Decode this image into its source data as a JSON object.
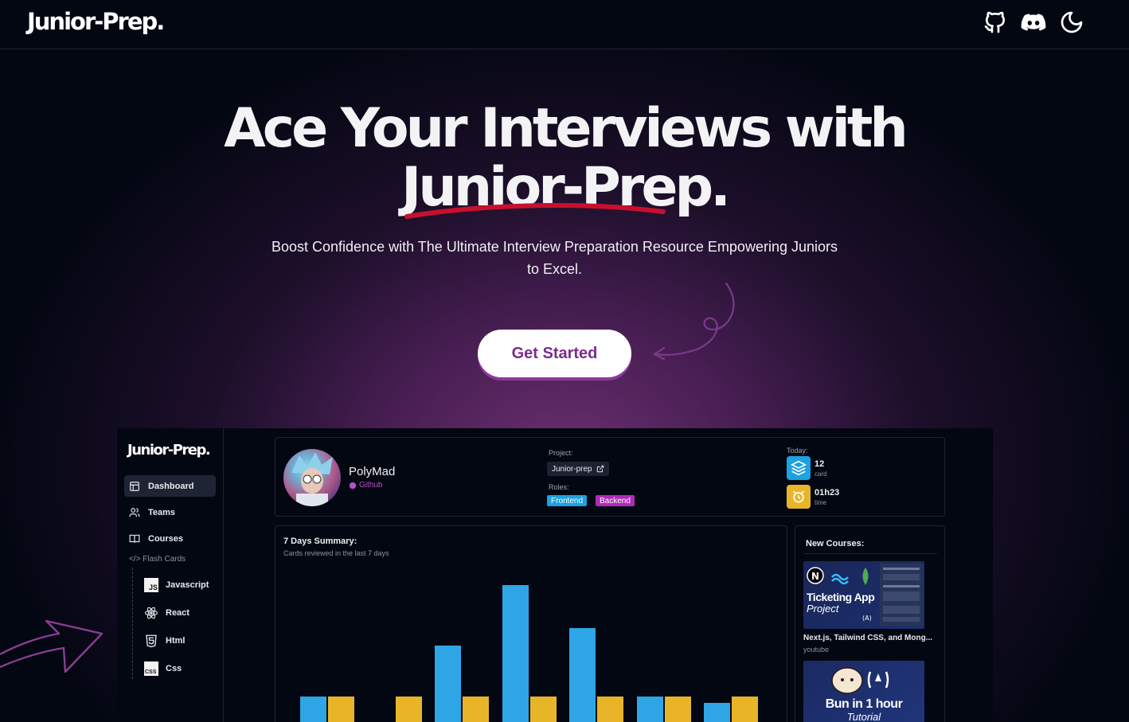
{
  "header": {
    "logo": "Junior-Prep.",
    "icons": [
      "github-icon",
      "discord-icon",
      "moon-icon"
    ]
  },
  "hero": {
    "title_line1": "Ace Your Interviews with",
    "title_line2": "Junior-Prep.",
    "subtitle": "Boost Confidence with The Ultimate Interview Preparation Resource Empowering Juniors to Excel.",
    "cta_label": "Get Started",
    "underline_color": "#c8102e"
  },
  "app": {
    "logo": "Junior-Prep.",
    "nav": [
      {
        "label": "Dashboard",
        "icon": "dashboard-icon"
      },
      {
        "label": "Teams",
        "icon": "users-icon"
      },
      {
        "label": "Courses",
        "icon": "book-icon"
      }
    ],
    "flash_title": "</> Flash Cards",
    "flash_items": [
      {
        "label": "Javascript",
        "icon": "js-icon"
      },
      {
        "label": "React",
        "icon": "react-icon"
      },
      {
        "label": "Html",
        "icon": "html5-icon"
      },
      {
        "label": "Css",
        "icon": "css-icon"
      }
    ],
    "profile": {
      "name": "PolyMad",
      "github": "Github",
      "project_label": "Project:",
      "project": "Junior-prep",
      "roles_label": "Roles:",
      "roles": [
        {
          "label": "Frontend",
          "color": "#1da1e0"
        },
        {
          "label": "Backend",
          "color": "#b02ab8"
        }
      ],
      "today_label": "Today:",
      "cards_value": "12",
      "cards_label": "card",
      "time_value": "01h23",
      "time_label": "time"
    },
    "summary": {
      "title": "7 Days Summary:",
      "subtitle": "Cards reviewed in the last 7 days",
      "colors": {
        "blue": "#2ea6e6",
        "yellow": "#e9b528"
      },
      "blue_values": [
        30,
        6,
        62,
        100,
        73,
        30,
        26
      ],
      "yellow_values": [
        30,
        30,
        30,
        30,
        30,
        30,
        30
      ]
    },
    "courses": {
      "title": "New Courses:",
      "items": [
        {
          "thumb_title": "Ticketing App",
          "thumb_sub": "Project",
          "name": "Next.js, Tailwind CSS, and Mong...",
          "source": "youtube"
        },
        {
          "thumb_title": "Bun in 1 hour",
          "thumb_sub": "Tutorial",
          "name": "",
          "source": ""
        }
      ]
    }
  }
}
